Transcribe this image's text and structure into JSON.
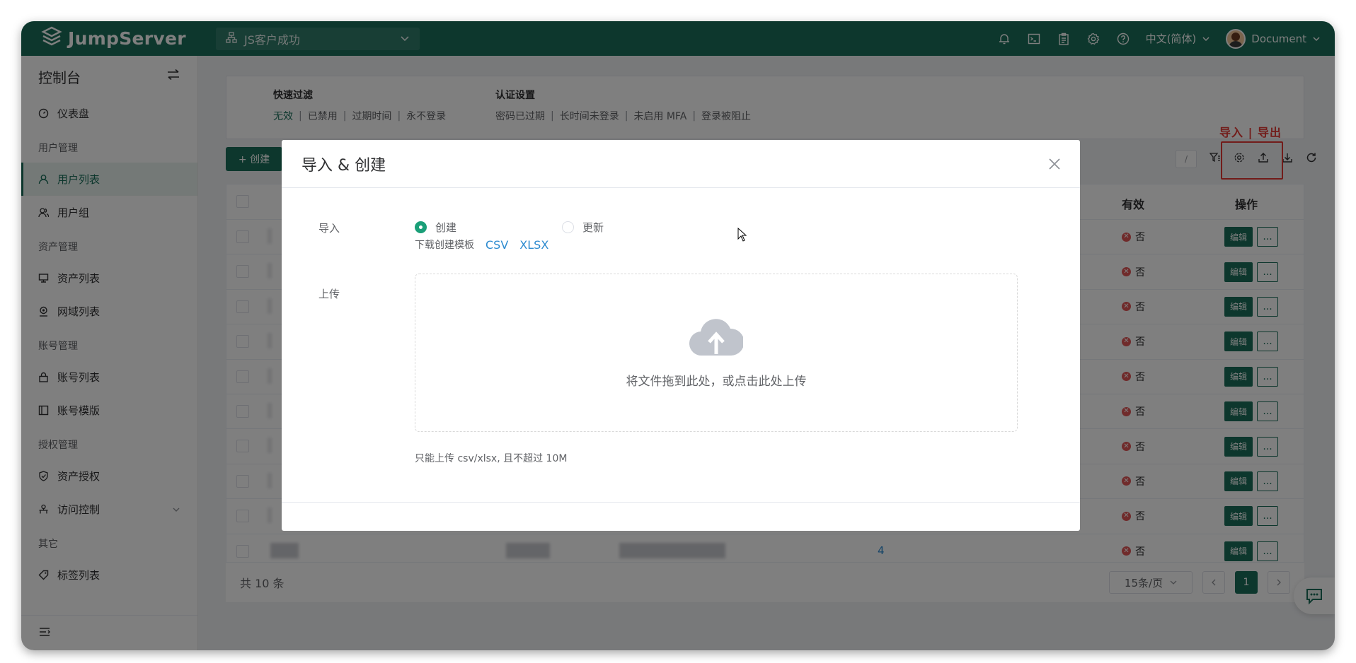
{
  "brand": {
    "name": "JumpServer"
  },
  "topbar": {
    "org": "JS客户成功",
    "language": "中文(简体)",
    "username": "Document",
    "icons": [
      "bell-icon",
      "terminal-icon",
      "clipboard-icon",
      "gear-icon",
      "help-icon"
    ]
  },
  "sidebar": {
    "title": "控制台",
    "groups": [
      {
        "label": "",
        "items": [
          {
            "label": "仪表盘",
            "icon": "dashboard-icon"
          }
        ]
      },
      {
        "label": "用户管理",
        "items": [
          {
            "label": "用户列表",
            "icon": "user-icon",
            "active": true
          },
          {
            "label": "用户组",
            "icon": "users-icon"
          }
        ]
      },
      {
        "label": "资产管理",
        "items": [
          {
            "label": "资产列表",
            "icon": "monitor-icon"
          },
          {
            "label": "网域列表",
            "icon": "location-icon"
          }
        ]
      },
      {
        "label": "账号管理",
        "items": [
          {
            "label": "账号列表",
            "icon": "lock-icon"
          },
          {
            "label": "账号模版",
            "icon": "template-icon"
          }
        ]
      },
      {
        "label": "授权管理",
        "items": [
          {
            "label": "资产授权",
            "icon": "shield-icon"
          },
          {
            "label": "访问控制",
            "icon": "access-icon"
          }
        ]
      },
      {
        "label": "其它",
        "items": [
          {
            "label": "标签列表",
            "icon": "tag-icon"
          }
        ]
      }
    ]
  },
  "filters": {
    "quick": {
      "title": "快速过滤",
      "items": [
        "无效",
        "已禁用",
        "过期时间",
        "永不登录"
      ]
    },
    "auth": {
      "title": "认证设置",
      "items": [
        "密码已过期",
        "长时间未登录",
        "未启用 MFA",
        "登录被阻止"
      ]
    }
  },
  "toolbar": {
    "create_label": "+ 创建",
    "search_shortcut": "/"
  },
  "annotation": {
    "label": "导入 | 导出",
    "color": "#e53935"
  },
  "table": {
    "header_valid": "有效",
    "header_ops": "操作",
    "rows": [
      {
        "valid": "否",
        "edit": "编辑",
        "more": "...",
        "extra": ""
      },
      {
        "valid": "否",
        "edit": "编辑",
        "more": "...",
        "extra": ""
      },
      {
        "valid": "否",
        "edit": "编辑",
        "more": "...",
        "extra": ""
      },
      {
        "valid": "否",
        "edit": "编辑",
        "more": "...",
        "extra": ""
      },
      {
        "valid": "否",
        "edit": "编辑",
        "more": "...",
        "extra": ""
      },
      {
        "valid": "否",
        "edit": "编辑",
        "more": "...",
        "extra": ""
      },
      {
        "valid": "否",
        "edit": "编辑",
        "more": "...",
        "extra": ""
      },
      {
        "valid": "否",
        "edit": "编辑",
        "more": "...",
        "extra": ""
      },
      {
        "valid": "否",
        "edit": "编辑",
        "more": "...",
        "extra": ""
      },
      {
        "valid": "否",
        "edit": "编辑",
        "more": "...",
        "extra": "4"
      }
    ],
    "total": "共 10 条",
    "page_size": "15条/页",
    "current_page": "1"
  },
  "dialog": {
    "title": "导入 & 创建",
    "import_label": "导入",
    "option_create": "创建",
    "option_update": "更新",
    "template_label": "下载创建模板",
    "template_csv": "CSV",
    "template_xlsx": "XLSX",
    "upload_label": "上传",
    "upload_text": "将文件拖到此处，或点击此处上传",
    "upload_hint": "只能上传 csv/xlsx, 且不超过 10M"
  },
  "colors": {
    "primary": "#1a6f5a",
    "danger": "#e05656",
    "link": "#2d8bd0"
  }
}
